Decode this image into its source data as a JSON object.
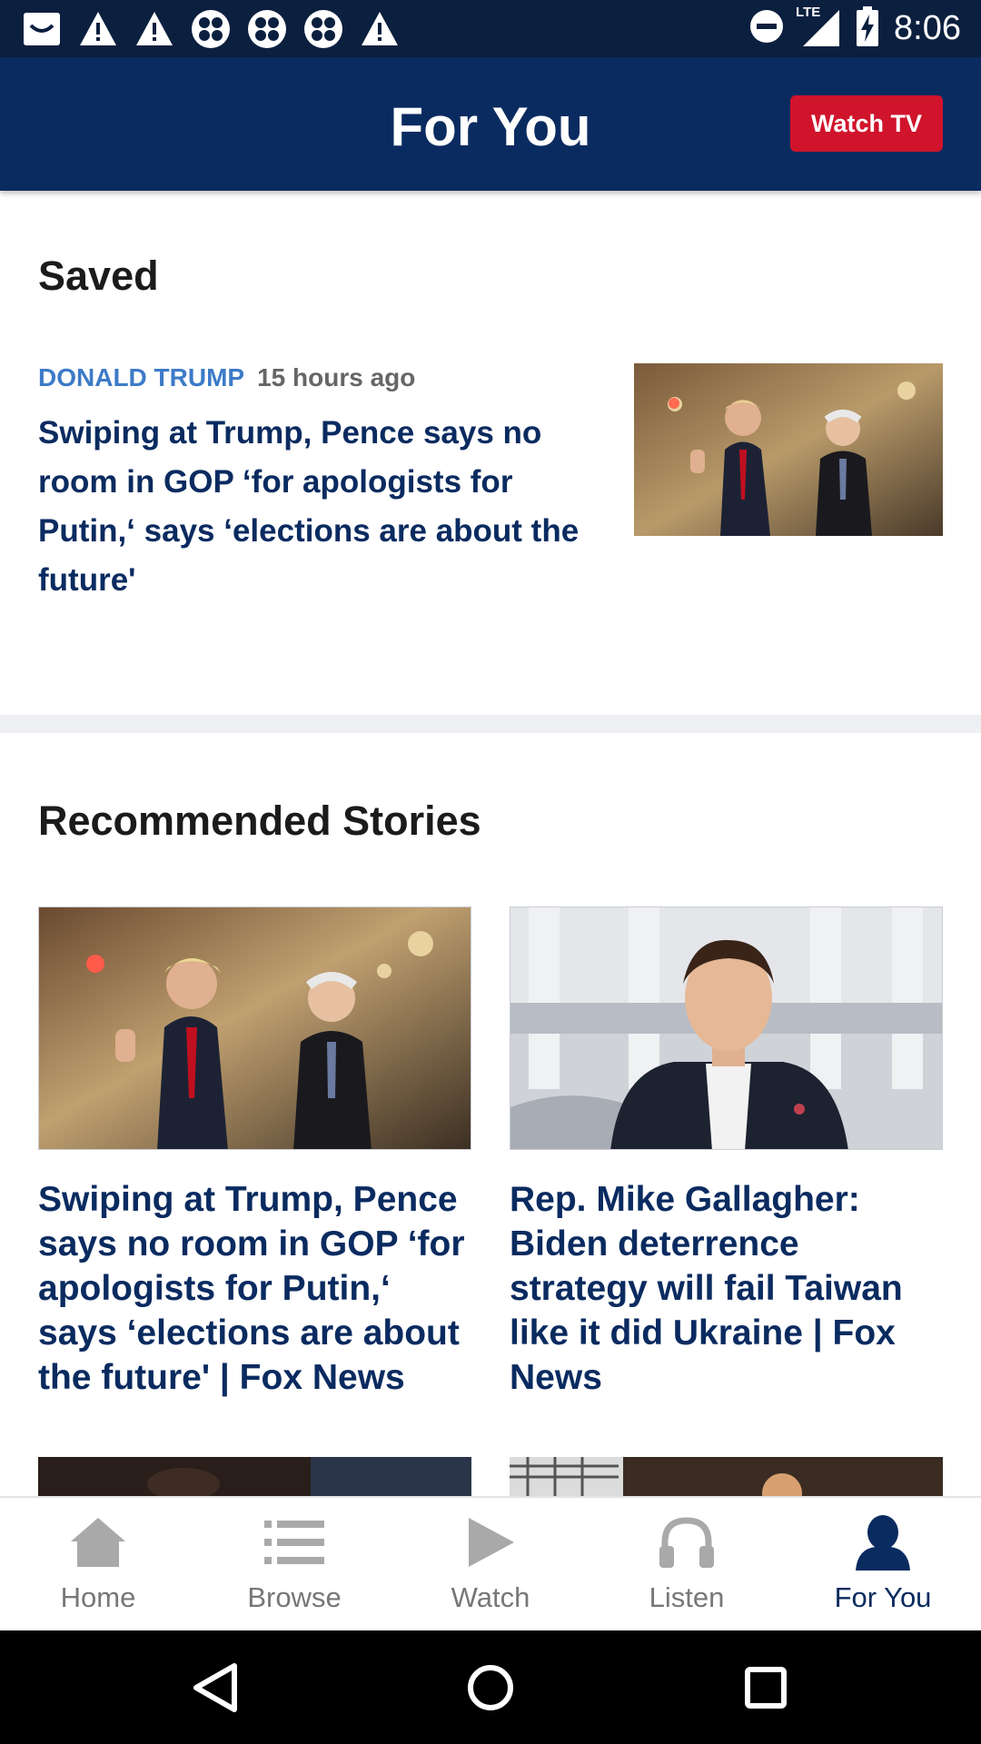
{
  "status_bar": {
    "time": "8:06",
    "network": "LTE",
    "icons": [
      "notification-icon",
      "warning-icon",
      "warning-icon",
      "app-icon",
      "app-icon",
      "app-icon",
      "warning-icon",
      "do-not-disturb-icon",
      "signal-icon",
      "battery-charging-icon"
    ]
  },
  "header": {
    "title": "For You",
    "watch_tv_label": "Watch TV"
  },
  "saved": {
    "section_title": "Saved",
    "item": {
      "category": "DONALD TRUMP",
      "time": "15 hours ago",
      "headline": "Swiping at Trump, Pence says no room in GOP ‘for apologists for Putin,‘ says ‘elections are about the future'"
    }
  },
  "recommended": {
    "section_title": "Recommended Stories",
    "cards": [
      {
        "headline": "Swiping at Trump, Pence says no room in GOP ‘for apologists for Putin,‘ says ‘elections are about the future' | Fox News"
      },
      {
        "headline": "Rep. Mike Gallagher: Biden deterrence strategy will fail Taiwan like it did Ukraine | Fox News"
      }
    ]
  },
  "bottom_nav": {
    "items": [
      {
        "label": "Home",
        "icon": "home-icon"
      },
      {
        "label": "Browse",
        "icon": "list-icon"
      },
      {
        "label": "Watch",
        "icon": "play-icon"
      },
      {
        "label": "Listen",
        "icon": "headphones-icon"
      },
      {
        "label": "For You",
        "icon": "person-icon"
      }
    ],
    "active_index": 4
  },
  "colors": {
    "header_bg": "#0a2b60",
    "status_bg": "#0b1f3f",
    "accent_red": "#d0142c",
    "headline_blue": "#0a2b60",
    "category_blue": "#3d7bc8"
  }
}
